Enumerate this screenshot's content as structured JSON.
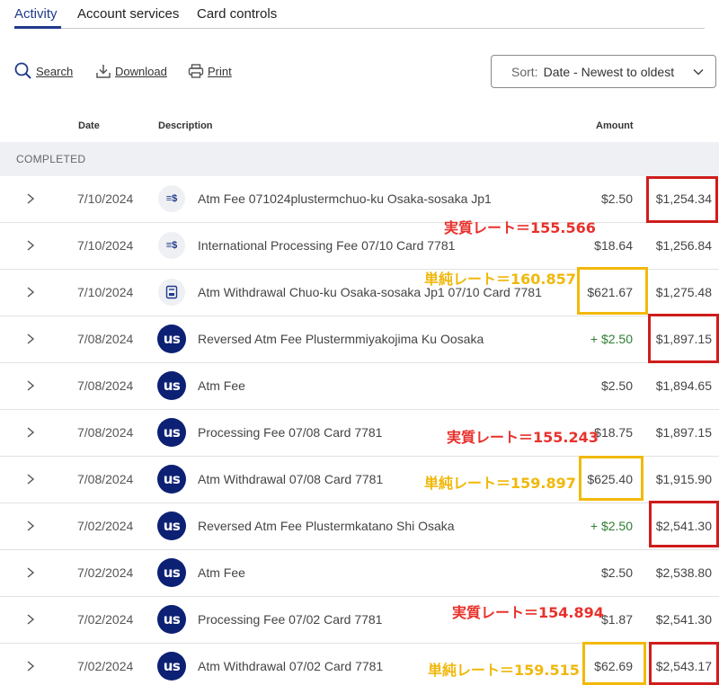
{
  "tabs": [
    {
      "label": "Activity",
      "active": true
    },
    {
      "label": "Account services",
      "active": false
    },
    {
      "label": "Card controls",
      "active": false
    }
  ],
  "toolbar": {
    "search_label": "Search",
    "download_label": "Download",
    "print_label": "Print",
    "sort_label": "Sort:",
    "sort_value": "Date - Newest to oldest"
  },
  "table": {
    "headers": {
      "date": "Date",
      "description": "Description",
      "amount": "Amount"
    },
    "section_label": "COMPLETED",
    "rows": [
      {
        "date": "7/10/2024",
        "icon": "fee-icon",
        "description": "Atm Fee 071024plustermchuo-ku Osaka-sosaka Jp1",
        "amount": "$2.50",
        "balance": "$1,254.34"
      },
      {
        "date": "7/10/2024",
        "icon": "fee-icon",
        "description": "International Processing Fee 07/10 Card 7781",
        "amount": "$18.64",
        "balance": "$1,256.84"
      },
      {
        "date": "7/10/2024",
        "icon": "atm-icon",
        "description": "Atm Withdrawal Chuo-ku Osaka-sosaka Jp1 07/10 Card 7781",
        "amount": "$621.67",
        "balance": "$1,275.48"
      },
      {
        "date": "7/08/2024",
        "icon": "us-bank-logo-icon",
        "description": "Reversed Atm Fee Plustermmiyakojima Ku Oosaka",
        "amount": "+ $2.50",
        "balance": "$1,897.15"
      },
      {
        "date": "7/08/2024",
        "icon": "us-bank-logo-icon",
        "description": "Atm Fee",
        "amount": "$2.50",
        "balance": "$1,894.65"
      },
      {
        "date": "7/08/2024",
        "icon": "us-bank-logo-icon",
        "description": "Processing Fee 07/08 Card 7781",
        "amount": "$18.75",
        "balance": "$1,897.15"
      },
      {
        "date": "7/08/2024",
        "icon": "us-bank-logo-icon",
        "description": "Atm Withdrawal 07/08 Card 7781",
        "amount": "$625.40",
        "balance": "$1,915.90"
      },
      {
        "date": "7/02/2024",
        "icon": "us-bank-logo-icon",
        "description": "Reversed Atm Fee Plustermkatano Shi Osaka",
        "amount": "+ $2.50",
        "balance": "$2,541.30"
      },
      {
        "date": "7/02/2024",
        "icon": "us-bank-logo-icon",
        "description": "Atm Fee",
        "amount": "$2.50",
        "balance": "$2,538.80"
      },
      {
        "date": "7/02/2024",
        "icon": "us-bank-logo-icon",
        "description": "Processing Fee 07/02 Card 7781",
        "amount": "$1.87",
        "balance": "$2,541.30"
      },
      {
        "date": "7/02/2024",
        "icon": "us-bank-logo-icon",
        "description": "Atm Withdrawal 07/02 Card 7781",
        "amount": "$62.69",
        "balance": "$2,543.17"
      }
    ]
  },
  "logo_text": "us",
  "annotations": {
    "note_1": "実質レート＝155.566",
    "note_2": "単純レート＝160.857",
    "note_3": "実質レート＝155.243",
    "note_4": "単純レート＝159.897",
    "note_5": "実質レート＝154.894",
    "note_6": "単純レート＝159.515"
  },
  "colors": {
    "brand_navy": "#0c2074",
    "active_tab": "#1f3a8a",
    "credit_green": "#2e7d32",
    "annotation_red": "#d01c1c",
    "annotation_yellow": "#f2b90c"
  }
}
